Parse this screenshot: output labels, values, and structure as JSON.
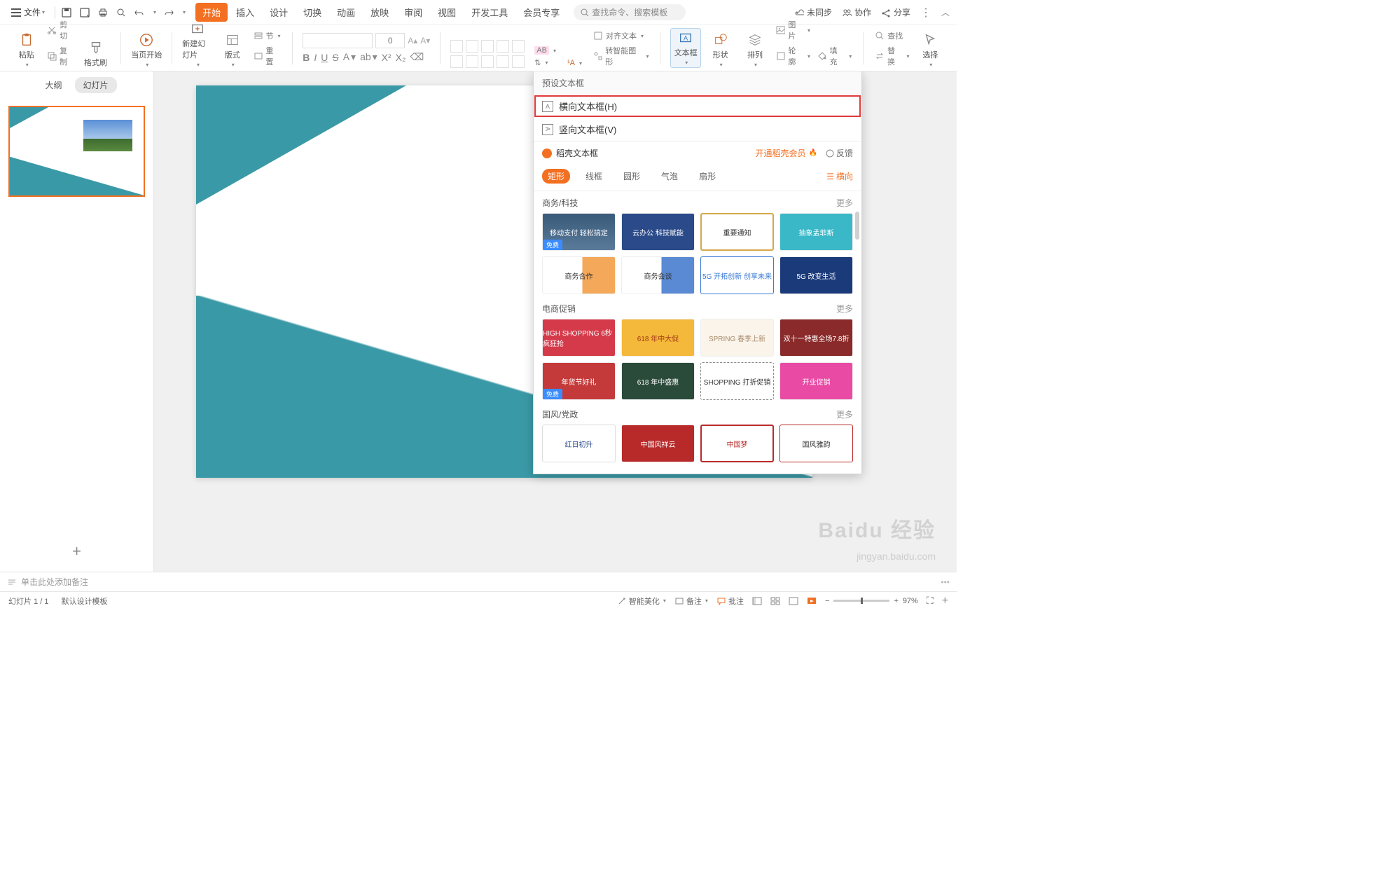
{
  "menu": {
    "file": "文件"
  },
  "tabs": [
    "开始",
    "插入",
    "设计",
    "切换",
    "动画",
    "放映",
    "审阅",
    "视图",
    "开发工具",
    "会员专享"
  ],
  "activeTab": 0,
  "searchPlaceholder": "查找命令、搜索模板",
  "topRight": {
    "sync": "未同步",
    "coop": "协作",
    "share": "分享"
  },
  "ribbon": {
    "paste": "粘贴",
    "cut": "剪切",
    "copy": "复制",
    "format": "格式刷",
    "curPage": "当页开始",
    "newSlide": "新建幻灯片",
    "layout": "版式",
    "section": "节",
    "reset": "重置",
    "fontSize": "0",
    "txtAlign": "对齐文本",
    "smartShape": "转智能图形",
    "textbox": "文本框",
    "shape": "形状",
    "arrange": "排列",
    "outline": "轮廓",
    "picture": "图片",
    "fill": "填充",
    "find": "查找",
    "replace": "替换",
    "select": "选择"
  },
  "leftPanel": {
    "outline": "大纲",
    "slides": "幻灯片",
    "slideNum": "1"
  },
  "notesPlaceholder": "单击此处添加备注",
  "status": {
    "slideCount": "幻灯片 1 / 1",
    "template": "默认设计模板",
    "beautify": "智能美化",
    "notes": "备注",
    "comment": "批注",
    "zoom": "97%"
  },
  "dropdown": {
    "presetTitle": "预设文本框",
    "horiz": "横向文本框(H)",
    "vert": "竖向文本框(V)",
    "shellTitle": "稻壳文本框",
    "openMember": "开通稻壳会员",
    "feedback": "反馈",
    "cats": [
      "矩形",
      "线框",
      "圆形",
      "气泡",
      "扇形"
    ],
    "hfilter": "横向",
    "sections": [
      {
        "title": "商务/科技",
        "more": "更多"
      },
      {
        "title": "电商促销",
        "more": "更多"
      },
      {
        "title": "国风/党政",
        "more": "更多"
      }
    ],
    "freeTag": "免费",
    "cards": {
      "biz": [
        "移动支付 轻松搞定",
        "云办公 科技赋能",
        "重要通知",
        "抽象孟菲斯",
        "商务合作",
        "商务会谈",
        "5G 开拓创新 创享未来",
        "5G 改变生活"
      ],
      "promo": [
        "HIGH SHOPPING 6秒疯狂抢",
        "618 年中大促",
        "SPRING 春季上新",
        "双十一特惠全场7.8折",
        "年货节好礼",
        "618 年中盛惠",
        "SHOPPING 打折促销",
        "开业促销"
      ],
      "guofeng": [
        "红日初升",
        "中国风祥云",
        "中国梦",
        "国风雅韵"
      ]
    }
  },
  "watermark": "Baidu 经验",
  "watermark2": "jingyan.baidu.com"
}
